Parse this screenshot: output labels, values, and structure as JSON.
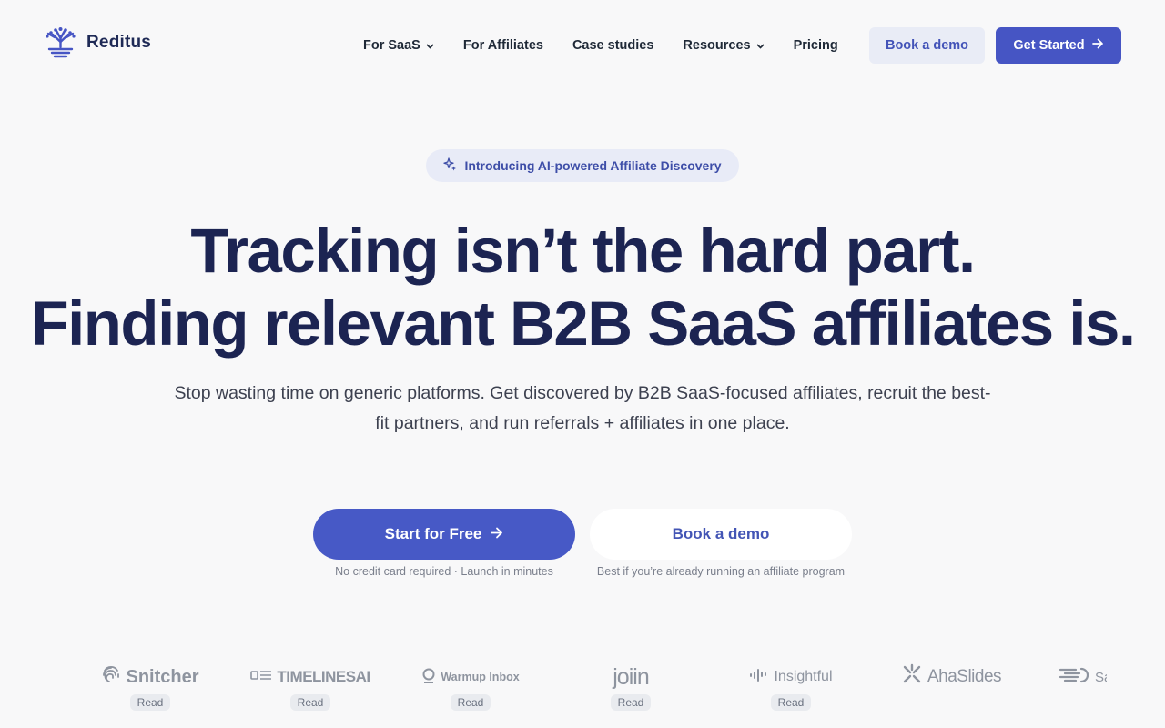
{
  "brand": {
    "name": "Reditus",
    "accent": "#4655c4",
    "logo_icon": "tree-icon"
  },
  "nav": {
    "links": [
      {
        "label": "For SaaS",
        "dropdown": true
      },
      {
        "label": "For Affiliates",
        "dropdown": false
      },
      {
        "label": "Case studies",
        "dropdown": false
      },
      {
        "label": "Resources",
        "dropdown": true
      },
      {
        "label": "Pricing",
        "dropdown": false
      }
    ],
    "demo_label": "Book a demo",
    "start_label": "Get Started"
  },
  "hero": {
    "pill": "Introducing AI-powered Affiliate Discovery",
    "headline_line1": "Tracking isn’t the hard part.",
    "headline_line2": "Finding relevant B2B SaaS affiliates is.",
    "subhead": "Stop wasting time on generic platforms. Get discovered by B2B SaaS-focused affiliates, recruit the best-fit partners, and run referrals + affiliates in one place.",
    "start_label": "Start for Free",
    "start_note": "No credit card required · Launch in minutes",
    "demo_label": "Book a demo",
    "demo_note": "Best if you’re already running an affiliate program"
  },
  "customers": [
    {
      "name": "Snitcher",
      "icon": "fingerprint-icon",
      "read": "Read"
    },
    {
      "name": "TIMELINESAI",
      "icon": "timeline-icon",
      "read": "Read"
    },
    {
      "name": "Warmup Inbox",
      "icon": "pin-icon",
      "read": "Read"
    },
    {
      "name": "joiin",
      "icon": "",
      "read": "Read"
    },
    {
      "name": "Insightful",
      "icon": "waveform-icon",
      "read": "Read"
    },
    {
      "name": "AhaSlides",
      "icon": "sparkle-icon",
      "read": ""
    },
    {
      "name": "Sa",
      "icon": "s-stripes-icon",
      "read": ""
    }
  ]
}
